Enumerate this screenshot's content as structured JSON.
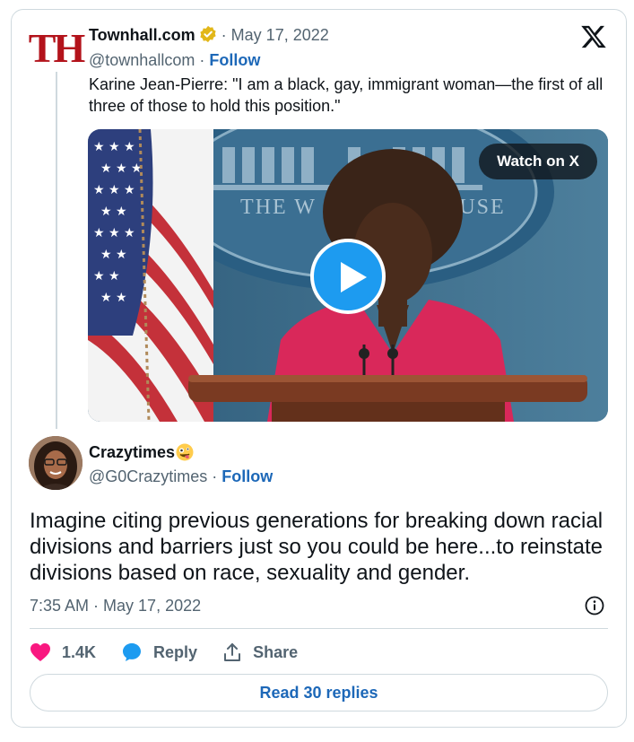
{
  "quoted_tweet": {
    "logo_text": "TH",
    "author_name": "Townhall.com",
    "date": "May 17, 2022",
    "handle": "@townhallcom",
    "follow_label": "Follow",
    "text": "Karine Jean-Pierre: \"I am a black, gay, immigrant woman—the first of all three of those to hold this position.\"",
    "video": {
      "watch_label": "Watch on X",
      "backdrop_text": "THE W",
      "backdrop_text_2": "OUSE"
    }
  },
  "reply_tweet": {
    "author_name": "Crazytimes",
    "handle": "@G0Crazytimes",
    "follow_label": "Follow",
    "text": "Imagine citing previous generations for breaking down racial divisions and barriers just so you could be here...to reinstate divisions based on race, sexuality and gender.",
    "timestamp": "7:35 AM · May 17, 2022"
  },
  "actions": {
    "like_count": "1.4K",
    "reply_label": "Reply",
    "share_label": "Share"
  },
  "read_replies_label": "Read 30 replies",
  "icons": [
    "verified-badge-icon",
    "x-logo-icon",
    "play-icon",
    "heart-icon",
    "reply-bubble-icon",
    "share-icon",
    "info-icon",
    "zany-face-emoji"
  ],
  "colors": {
    "brand_blue": "#1d9bf0",
    "link_blue": "#1d68b8",
    "like_pink": "#f91880",
    "muted": "#536471",
    "border": "#cfd9de",
    "townhall_red": "#b3131b"
  }
}
